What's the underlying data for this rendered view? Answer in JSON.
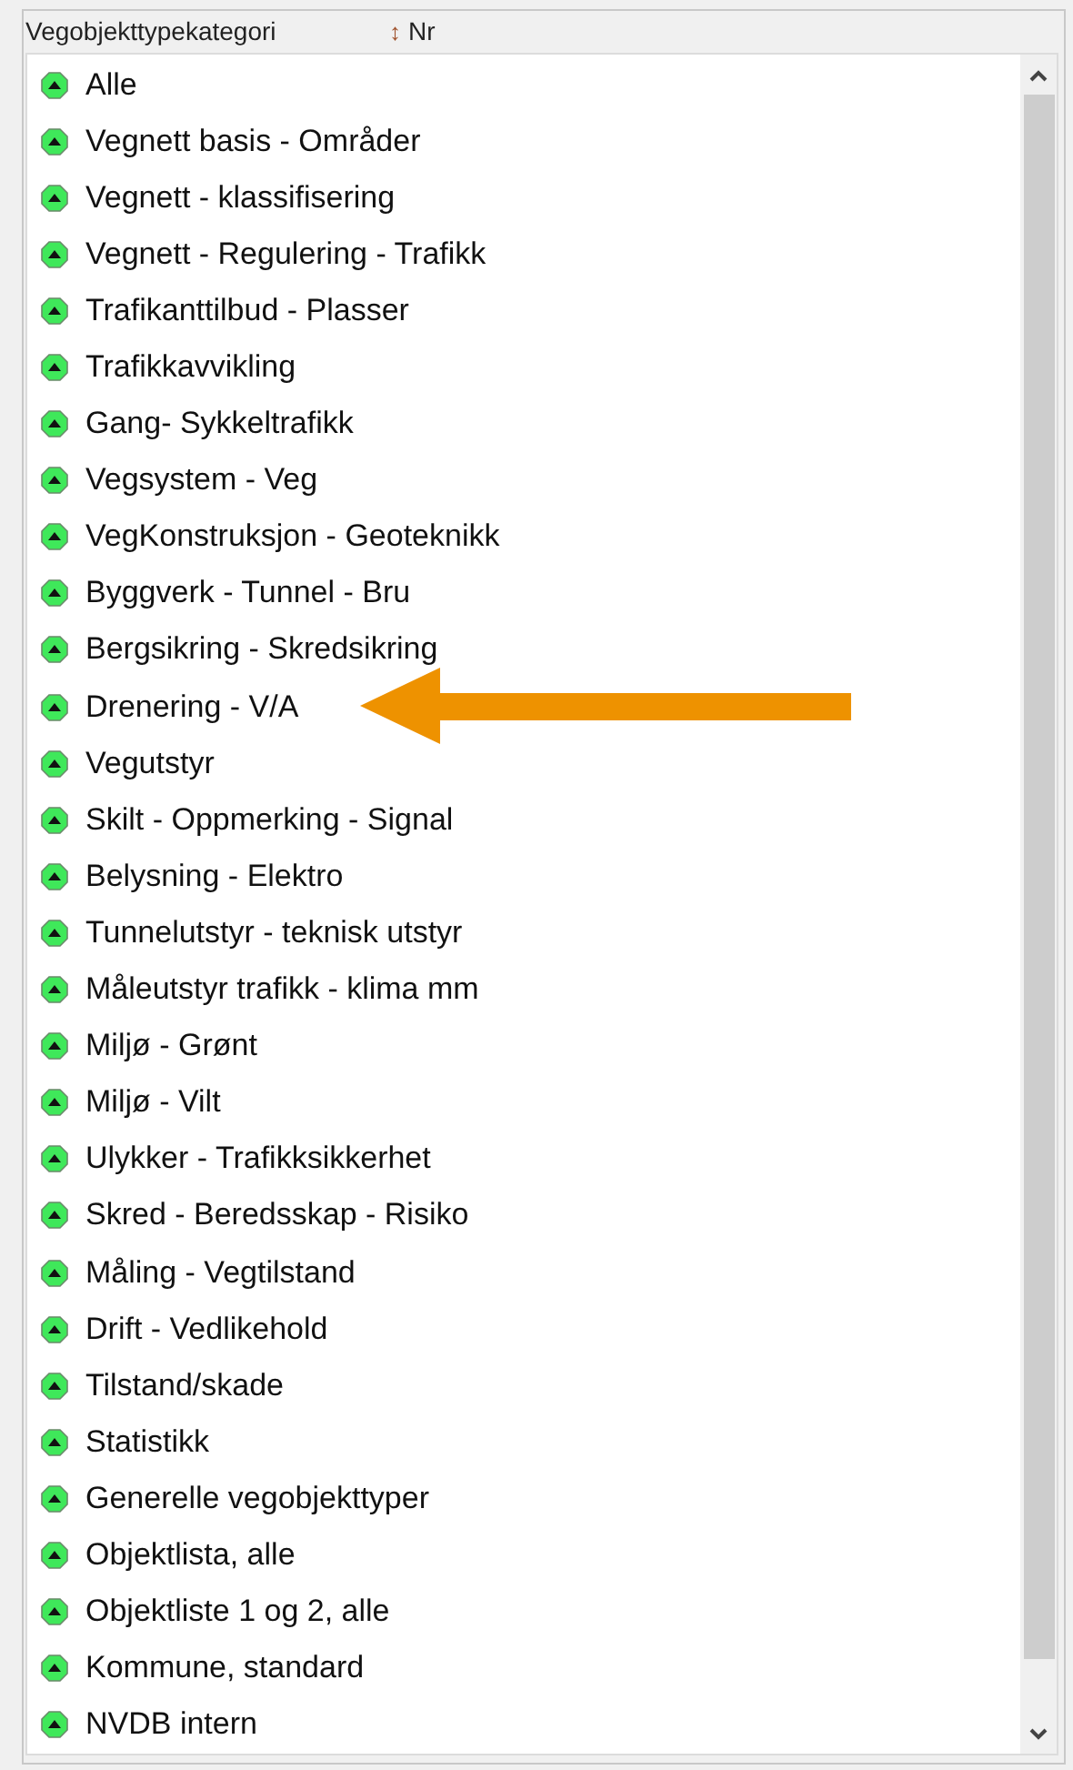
{
  "header": {
    "columns": [
      {
        "label": "Vegobjekttypekategori"
      },
      {
        "label": "Nr",
        "sort_icon": "↕"
      }
    ]
  },
  "items": [
    {
      "label": "Alle"
    },
    {
      "label": "Vegnett basis - Områder"
    },
    {
      "label": "Vegnett - klassifisering"
    },
    {
      "label": "Vegnett - Regulering - Trafikk"
    },
    {
      "label": "Trafikanttilbud - Plasser"
    },
    {
      "label": "Trafikkavvikling"
    },
    {
      "label": "Gang- Sykkeltrafikk"
    },
    {
      "label": "Vegsystem - Veg"
    },
    {
      "label": "VegKonstruksjon - Geoteknikk"
    },
    {
      "label": "Byggverk - Tunnel - Bru"
    },
    {
      "label": "Bergsikring - Skredsikring"
    },
    {
      "label": "Drenering - V/A"
    },
    {
      "label": "Vegutstyr"
    },
    {
      "label": "Skilt - Oppmerking - Signal"
    },
    {
      "label": "Belysning - Elektro"
    },
    {
      "label": "Tunnelutstyr - teknisk utstyr"
    },
    {
      "label": "Måleutstyr trafikk - klima mm"
    },
    {
      "label": "Miljø - Grønt"
    },
    {
      "label": "Miljø - Vilt"
    },
    {
      "label": "Ulykker - Trafikksikkerhet"
    },
    {
      "label": "Skred - Beredsskap - Risiko"
    },
    {
      "label": "Måling - Vegtilstand"
    },
    {
      "label": "Drift - Vedlikehold"
    },
    {
      "label": "Tilstand/skade"
    },
    {
      "label": "Statistikk"
    },
    {
      "label": "Generelle vegobjekttyper"
    },
    {
      "label": "Objektlista, alle"
    },
    {
      "label": "Objektliste 1 og 2, alle"
    },
    {
      "label": "Kommune, standard"
    },
    {
      "label": "NVDB intern"
    }
  ]
}
